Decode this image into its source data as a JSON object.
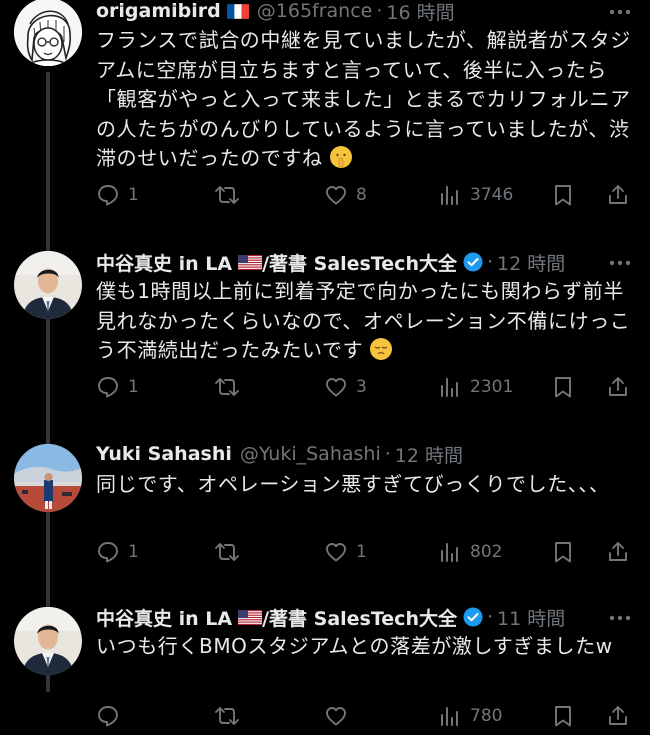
{
  "tweets": [
    {
      "name": "origamibird",
      "flag": "fr",
      "handle": "@165france",
      "time": "16 時間",
      "body": "フランスで試合の中継を見ていましたが、解説者がスタジアムに空席が目立ちますと言っていて、後半に入ったら「観客がやっと入って来ました」とまるでカリフォルニアの人たちがのんびりしているように言っていましたが、渋滞のせいだったのですね",
      "emoji": "shushing-face",
      "replies": "1",
      "reposts": "",
      "likes": "8",
      "views": "3746"
    },
    {
      "name": "中谷真史 in LA",
      "flag": "us",
      "name_suffix": "/著書 SalesTech大全",
      "verified": true,
      "time": "12 時間",
      "body": "僕も1時間以上前に到着予定で向かったにも関わらず前半見れなかったくらいなので、オペレーション不備にけっこう不満続出だったみたいです",
      "emoji": "pensive-face",
      "replies": "1",
      "reposts": "",
      "likes": "3",
      "views": "2301"
    },
    {
      "name": "Yuki Sahashi",
      "handle": "@Yuki_Sahashi",
      "time": "12 時間",
      "body": "同じです、オペレーション悪すぎてびっくりでした、、、",
      "replies": "1",
      "reposts": "",
      "likes": "1",
      "views": "802"
    },
    {
      "name": "中谷真史 in LA",
      "flag": "us",
      "name_suffix": "/著書 SalesTech大全",
      "verified": true,
      "time": "11 時間",
      "body": "いつも行くBMOスタジアムとの落差が激しすぎましたw",
      "replies": "",
      "reposts": "",
      "likes": "",
      "views": "780"
    }
  ],
  "separator": "·",
  "colors": {
    "background": "#000000",
    "text": "#e7e9ea",
    "secondary": "#71767b",
    "thread_line": "#333639",
    "verified": "#1d9bf0"
  }
}
